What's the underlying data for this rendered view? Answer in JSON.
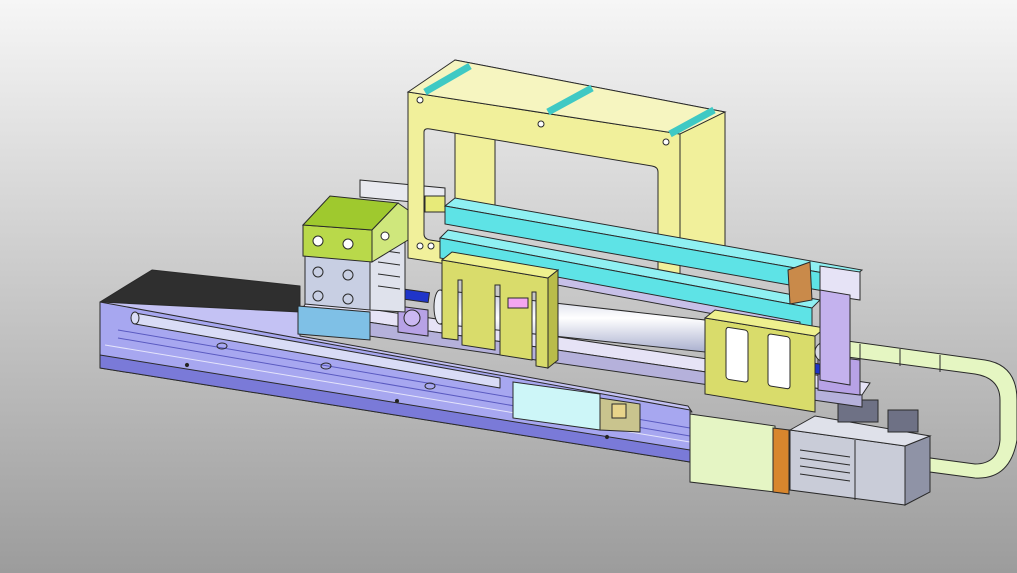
{
  "viewport": {
    "background_top": "#f6f6f6",
    "background_bottom": "#9c9c9c"
  },
  "colors": {
    "outline": "#2a2a2a",
    "base_rail_blue": "#a7a7f0",
    "base_rail_dark": "#7a7ad8",
    "cover_black": "#2f2f2f",
    "plate_lavender": "#d6d2ee",
    "frame_yellow": "#f1f09b",
    "bracket_olive": "#d9dc6b",
    "rail_cyan": "#5ee3e6",
    "rod_teal": "#3fc9c4",
    "cylinder_block": "#c8cfe3",
    "cylinder_green": "#b9d94a",
    "cylinder_base": "#7fc0e6",
    "carriage_cyan": "#cdf6f8",
    "chain_green": "#e5f6c2",
    "motor_grey": "#c9ccd8",
    "pillow_purple": "#b7a2e6",
    "bolt_blue": "#1f35c9",
    "copper_strip": "#d8862d",
    "stop_brown": "#c98a4a",
    "roller_silver": "#e9ecf5"
  },
  "parts": [
    {
      "name": "linear-module-base",
      "icon": "linear-module-icon"
    },
    {
      "name": "air-cylinder",
      "icon": "cylinder-icon"
    },
    {
      "name": "lifting-frame",
      "icon": "frame-icon"
    },
    {
      "name": "guide-rail",
      "icon": "rail-icon"
    },
    {
      "name": "cable-drag-chain",
      "icon": "drag-chain-icon"
    },
    {
      "name": "servo-motor",
      "icon": "motor-icon"
    }
  ]
}
